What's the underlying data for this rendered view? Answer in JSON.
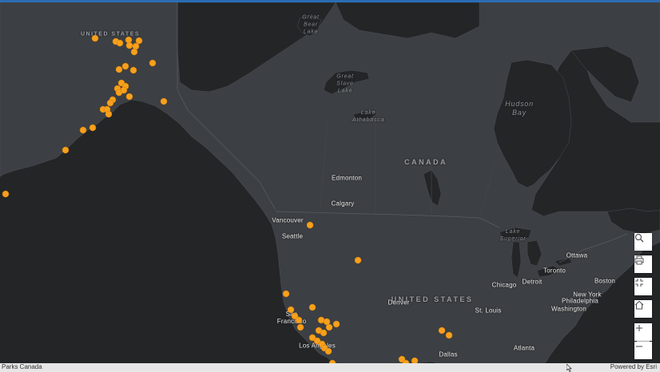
{
  "attribution": {
    "source": "Parks Canada",
    "powered": "Powered by Esri"
  },
  "region_labels": [
    {
      "text": "CANADA",
      "size": "lg"
    },
    {
      "text": "UNITED STATES",
      "size": "lg"
    },
    {
      "text": "UNITED STATES",
      "size": "sm"
    }
  ],
  "water_labels": [
    {
      "text": "Great\nBear\nLake"
    },
    {
      "text": "Great\nSlave\nLake"
    },
    {
      "text": "Lake\nAthabasca"
    },
    {
      "text": "Hudson\nBay"
    },
    {
      "text": "Lake\nSuperior"
    }
  ],
  "city_labels": [
    "Edmonton",
    "Calgary",
    "Vancouver",
    "Seattle",
    "San\nFrancisco",
    "Los Angeles",
    "Denver",
    "Dallas",
    "Chicago",
    "Detroit",
    "St. Louis",
    "Atlanta",
    "Toronto",
    "Ottawa",
    "Boston",
    "New York",
    "Philadelphia",
    "Washington"
  ],
  "marker_color": "#f7a01c",
  "controls": [
    {
      "name": "search-icon",
      "label": "Search"
    },
    {
      "name": "print-icon",
      "label": "Print"
    },
    {
      "name": "fullscreen-icon",
      "label": "Fullscreen"
    },
    {
      "name": "home-icon",
      "label": "Home"
    },
    {
      "name": "zoom-in-icon",
      "label": "+"
    },
    {
      "name": "zoom-out-icon",
      "label": "−"
    }
  ]
}
